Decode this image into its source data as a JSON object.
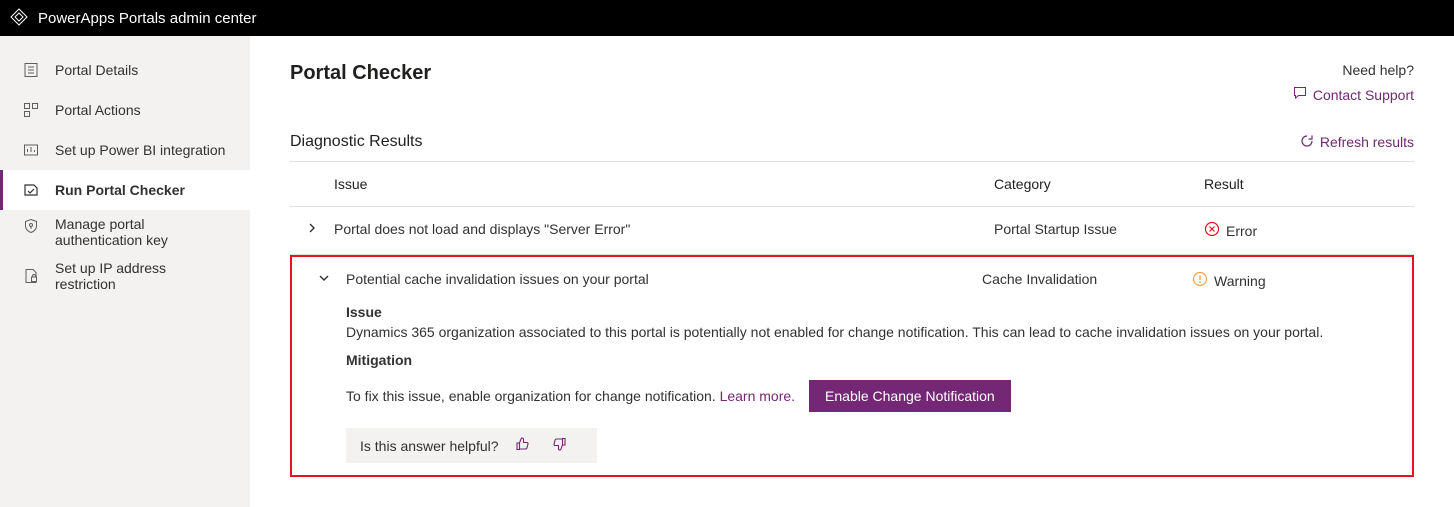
{
  "app": {
    "title": "PowerApps Portals admin center"
  },
  "sidebar": {
    "items": [
      {
        "label": "Portal Details"
      },
      {
        "label": "Portal Actions"
      },
      {
        "label": "Set up Power BI integration"
      },
      {
        "label": "Run Portal Checker"
      },
      {
        "label": "Manage portal authentication key"
      },
      {
        "label": "Set up IP address restriction"
      }
    ]
  },
  "main": {
    "page_title": "Portal Checker",
    "need_help": "Need help?",
    "contact_support": "Contact Support",
    "diag_title": "Diagnostic Results",
    "refresh": "Refresh results",
    "columns": {
      "issue": "Issue",
      "category": "Category",
      "result": "Result"
    },
    "rows": [
      {
        "issue": "Portal does not load and displays \"Server Error\"",
        "category": "Portal Startup Issue",
        "result": "Error"
      },
      {
        "issue": "Potential cache invalidation issues on your portal",
        "category": "Cache Invalidation",
        "result": "Warning"
      }
    ],
    "detail": {
      "issue_label": "Issue",
      "issue_text": "Dynamics 365 organization associated to this portal is potentially not enabled for change notification. This can lead to cache invalidation issues on your portal.",
      "mitigation_label": "Mitigation",
      "mitigation_text": "To fix this issue, enable organization for change notification.",
      "learn_more": "Learn more",
      "action_button": "Enable Change Notification",
      "feedback_prompt": "Is this answer helpful?"
    }
  },
  "colors": {
    "accent": "#742774",
    "error": "#e81123",
    "warning": "#f7a24b"
  }
}
